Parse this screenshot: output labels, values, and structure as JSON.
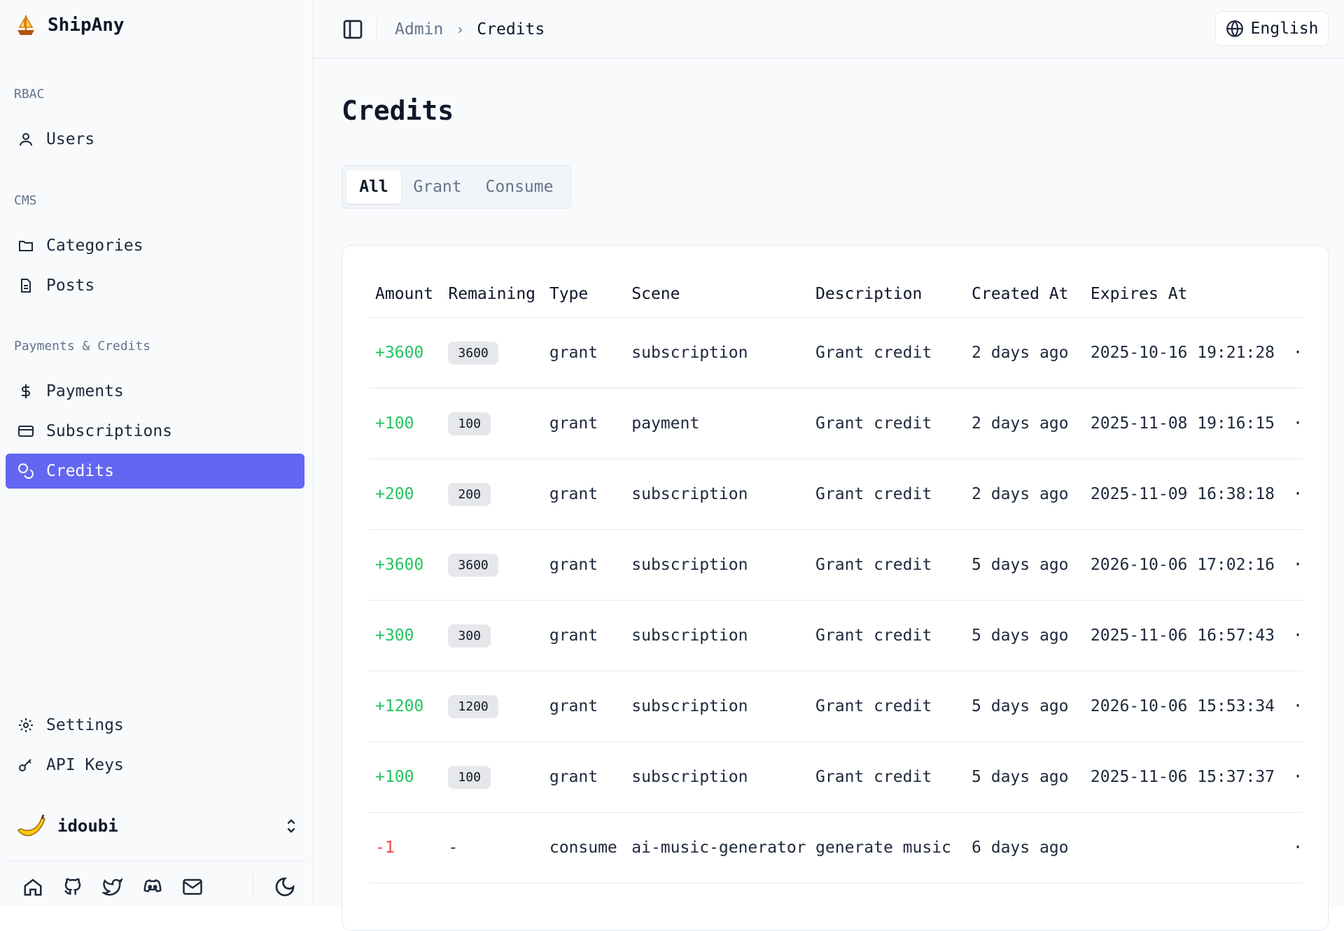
{
  "brand": {
    "name": "ShipAny"
  },
  "sidebar": {
    "groups": [
      {
        "label": "RBAC"
      },
      {
        "label": "CMS"
      },
      {
        "label": "Payments & Credits"
      }
    ],
    "items": [
      {
        "label": "Users",
        "icon": "user-icon"
      },
      {
        "label": "Categories",
        "icon": "folder-icon"
      },
      {
        "label": "Posts",
        "icon": "file-text-icon"
      },
      {
        "label": "Payments",
        "icon": "dollar-icon"
      },
      {
        "label": "Subscriptions",
        "icon": "credit-card-icon"
      },
      {
        "label": "Credits",
        "icon": "coins-icon",
        "active": true
      },
      {
        "label": "Settings",
        "icon": "gear-icon"
      },
      {
        "label": "API Keys",
        "icon": "key-icon"
      }
    ],
    "user": {
      "name": "idoubi"
    },
    "footer_icons": [
      "home-icon",
      "github-icon",
      "twitter-icon",
      "discord-icon",
      "mail-icon",
      "moon-icon"
    ]
  },
  "header": {
    "breadcrumb": [
      "Admin",
      "Credits"
    ],
    "language": "English"
  },
  "main": {
    "title": "Credits",
    "tabs": [
      "All",
      "Grant",
      "Consume"
    ],
    "active_tab": "All",
    "table": {
      "columns": [
        "Amount",
        "Remaining",
        "Type",
        "Scene",
        "Description",
        "Created At",
        "Expires At"
      ],
      "rows": [
        {
          "amount": "+3600",
          "remaining": "3600",
          "type": "grant",
          "scene": "subscription",
          "description": "Grant credit",
          "created": "2 days ago",
          "expires": "2025-10-16 19:21:28"
        },
        {
          "amount": "+100",
          "remaining": "100",
          "type": "grant",
          "scene": "payment",
          "description": "Grant credit",
          "created": "2 days ago",
          "expires": "2025-11-08 19:16:15"
        },
        {
          "amount": "+200",
          "remaining": "200",
          "type": "grant",
          "scene": "subscription",
          "description": "Grant credit",
          "created": "2 days ago",
          "expires": "2025-11-09 16:38:18"
        },
        {
          "amount": "+3600",
          "remaining": "3600",
          "type": "grant",
          "scene": "subscription",
          "description": "Grant credit",
          "created": "5 days ago",
          "expires": "2026-10-06 17:02:16"
        },
        {
          "amount": "+300",
          "remaining": "300",
          "type": "grant",
          "scene": "subscription",
          "description": "Grant credit",
          "created": "5 days ago",
          "expires": "2025-11-06 16:57:43"
        },
        {
          "amount": "+1200",
          "remaining": "1200",
          "type": "grant",
          "scene": "subscription",
          "description": "Grant credit",
          "created": "5 days ago",
          "expires": "2026-10-06 15:53:34"
        },
        {
          "amount": "+100",
          "remaining": "100",
          "type": "grant",
          "scene": "subscription",
          "description": "Grant credit",
          "created": "5 days ago",
          "expires": "2025-11-06 15:37:37"
        },
        {
          "amount": "-1",
          "remaining": "-",
          "type": "consume",
          "scene": "ai-music-generator",
          "description": "generate music",
          "created": "6 days ago",
          "expires": ""
        }
      ]
    }
  },
  "colors": {
    "accent": "#6366f1",
    "positive": "#22c55e",
    "negative": "#ef4444"
  }
}
